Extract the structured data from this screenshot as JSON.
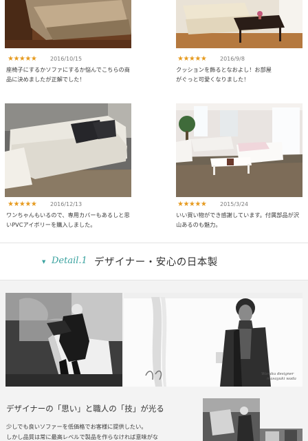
{
  "reviews": [
    {
      "stars": "★★★★★",
      "date": "2016/10/15",
      "text": "座椅子にするかソファにするか悩んでこちらの商品に決めましたが正解でした！"
    },
    {
      "stars": "★★★★★",
      "date": "2016/9/8",
      "text": "クッションを飾るとなおよし！お部屋がぐっと可愛くなりました！"
    },
    {
      "stars": "★★★★★",
      "date": "2016/12/13",
      "text": "ワンちゃんもいるので、専用カバーもあるしと思いPVCアイボリーを購入しました。"
    },
    {
      "stars": "★★★★★",
      "date": "2015/3/24",
      "text": "いい買い物ができ感謝しています。付属部品が沢山あるのも魅力。"
    }
  ],
  "detail": {
    "label": "Detail.1",
    "title": "デザイナー・安心の日本製"
  },
  "signature": {
    "line1": "Waraku designer",
    "line2": "masayuki wada"
  },
  "craft": {
    "title": "デザイナーの「思い」と職人の「技」が光る",
    "line1": "少しでも良いソファーを低価格でお客様に提供したい。",
    "line2": "しかし品質は常に最高レベルで製品を作らなければ意味がな"
  },
  "colors": {
    "star": "#e69a1e",
    "accent": "#3aa29f"
  }
}
